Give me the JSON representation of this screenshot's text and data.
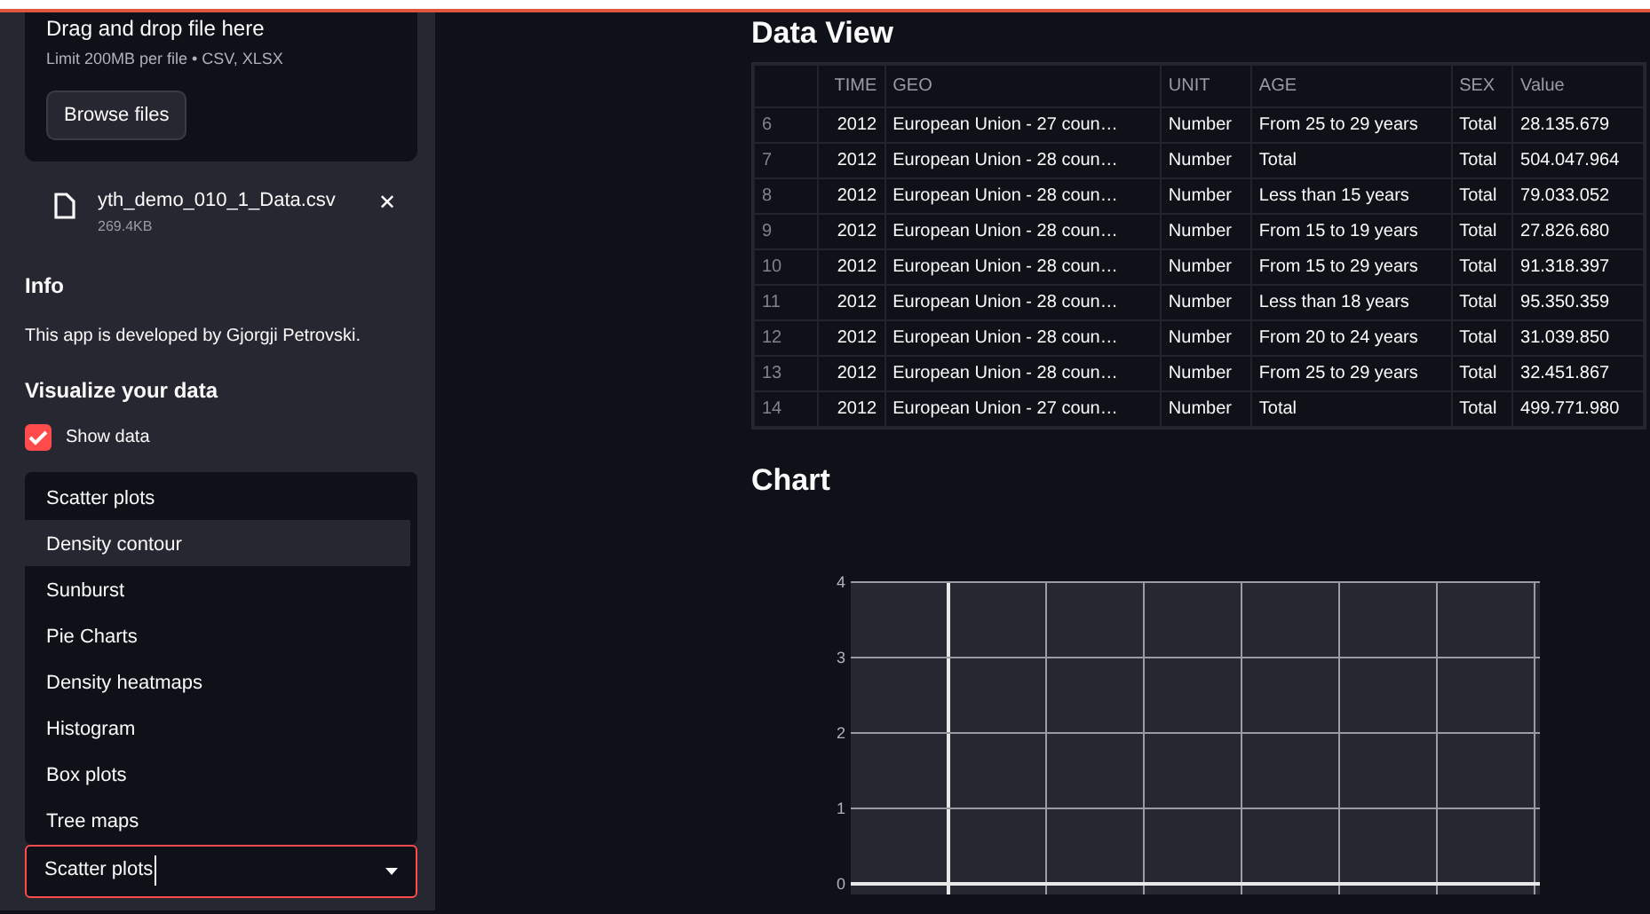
{
  "sidebar": {
    "uploader": {
      "title": "Drag and drop file here",
      "limit": "Limit 200MB per file • CSV, XLSX",
      "button": "Browse files"
    },
    "file": {
      "name": "yth_demo_010_1_Data.csv",
      "size": "269.4KB",
      "remove": "✕"
    },
    "info_heading": "Info",
    "info_text": "This app is developed by Gjorgji Petrovski.",
    "visualize_heading": "Visualize your data",
    "show_data": {
      "label": "Show data",
      "checked": true
    },
    "chart_options": [
      {
        "label": "Scatter plots",
        "selected": false
      },
      {
        "label": "Density contour",
        "selected": true
      },
      {
        "label": "Sunburst",
        "selected": false
      },
      {
        "label": "Pie Charts",
        "selected": false
      },
      {
        "label": "Density heatmaps",
        "selected": false
      },
      {
        "label": "Histogram",
        "selected": false
      },
      {
        "label": "Box plots",
        "selected": false
      },
      {
        "label": "Tree maps",
        "selected": false
      }
    ],
    "chart_select": {
      "value": "Scatter plots"
    }
  },
  "data_view": {
    "title": "Data View",
    "columns": [
      "",
      "TIME",
      "GEO",
      "UNIT",
      "AGE",
      "SEX",
      "Value"
    ],
    "rows": [
      [
        "6",
        "2012",
        "European Union - 27 coun…",
        "Number",
        "From 25 to 29 years",
        "Total",
        "28.135.679"
      ],
      [
        "7",
        "2012",
        "European Union - 28 coun…",
        "Number",
        "Total",
        "Total",
        "504.047.964"
      ],
      [
        "8",
        "2012",
        "European Union - 28 coun…",
        "Number",
        "Less than 15 years",
        "Total",
        "79.033.052"
      ],
      [
        "9",
        "2012",
        "European Union - 28 coun…",
        "Number",
        "From 15 to 19 years",
        "Total",
        "27.826.680"
      ],
      [
        "10",
        "2012",
        "European Union - 28 coun…",
        "Number",
        "From 15 to 29 years",
        "Total",
        "91.318.397"
      ],
      [
        "11",
        "2012",
        "European Union - 28 coun…",
        "Number",
        "Less than 18 years",
        "Total",
        "95.350.359"
      ],
      [
        "12",
        "2012",
        "European Union - 28 coun…",
        "Number",
        "From 20 to 24 years",
        "Total",
        "31.039.850"
      ],
      [
        "13",
        "2012",
        "European Union - 28 coun…",
        "Number",
        "From 25 to 29 years",
        "Total",
        "32.451.867"
      ],
      [
        "14",
        "2012",
        "European Union - 27 coun…",
        "Number",
        "Total",
        "Total",
        "499.771.980"
      ]
    ]
  },
  "chart": {
    "title": "Chart",
    "chart_data": {
      "type": "scatter",
      "categories": [
        null,
        null,
        null,
        null,
        null,
        null,
        null
      ],
      "grid": true,
      "ylim": [
        0,
        4
      ],
      "yticks": [
        0,
        1,
        2,
        3,
        4
      ]
    }
  }
}
